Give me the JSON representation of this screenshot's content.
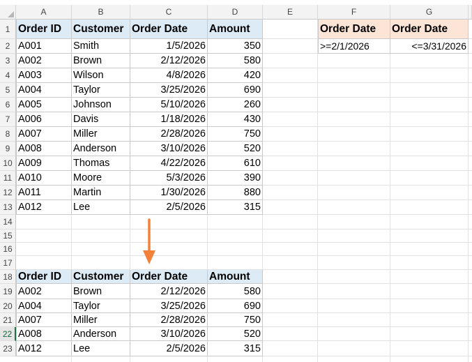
{
  "colors": {
    "header_fill": "#ddebf7",
    "criteria_header_fill": "#fce4d6",
    "arrow": "#f4813a"
  },
  "columns": [
    "A",
    "B",
    "C",
    "D",
    "E",
    "F",
    "G"
  ],
  "rows": [
    "1",
    "2",
    "3",
    "4",
    "5",
    "6",
    "7",
    "8",
    "9",
    "10",
    "11",
    "12",
    "13",
    "14",
    "15",
    "16",
    "17",
    "18",
    "19",
    "20",
    "21",
    "22",
    "23"
  ],
  "source_table": {
    "headers": [
      "Order ID",
      "Customer",
      "Order Date",
      "Amount"
    ],
    "rows": [
      [
        "A001",
        "Smith",
        "1/5/2026",
        "350"
      ],
      [
        "A002",
        "Brown",
        "2/12/2026",
        "580"
      ],
      [
        "A003",
        "Wilson",
        "4/8/2026",
        "420"
      ],
      [
        "A004",
        "Taylor",
        "3/25/2026",
        "690"
      ],
      [
        "A005",
        "Johnson",
        "5/10/2026",
        "260"
      ],
      [
        "A006",
        "Davis",
        "1/18/2026",
        "430"
      ],
      [
        "A007",
        "Miller",
        "2/28/2026",
        "750"
      ],
      [
        "A008",
        "Anderson",
        "3/10/2026",
        "520"
      ],
      [
        "A009",
        "Thomas",
        "4/22/2026",
        "610"
      ],
      [
        "A010",
        "Moore",
        "5/3/2026",
        "390"
      ],
      [
        "A011",
        "Martin",
        "1/30/2026",
        "880"
      ],
      [
        "A012",
        "Lee",
        "2/5/2026",
        "315"
      ]
    ]
  },
  "criteria": {
    "headers": [
      "Order Date",
      "Order Date"
    ],
    "values": [
      ">=2/1/2026",
      "<=3/31/2026"
    ]
  },
  "result_table": {
    "headers": [
      "Order ID",
      "Customer",
      "Order Date",
      "Amount"
    ],
    "rows": [
      [
        "A002",
        "Brown",
        "2/12/2026",
        "580"
      ],
      [
        "A004",
        "Taylor",
        "3/25/2026",
        "690"
      ],
      [
        "A007",
        "Miller",
        "2/28/2026",
        "750"
      ],
      [
        "A008",
        "Anderson",
        "3/10/2026",
        "520"
      ],
      [
        "A012",
        "Lee",
        "2/5/2026",
        "315"
      ]
    ]
  },
  "active_row": "22",
  "arrow_icon": "arrow-down-icon"
}
